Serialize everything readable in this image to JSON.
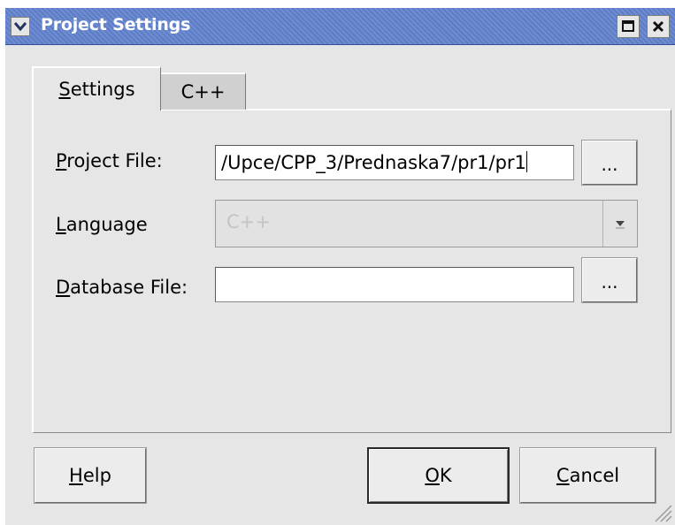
{
  "window": {
    "title": "Project Settings",
    "controls": {
      "menu_icon": "chevron-down-icon",
      "maximize_icon": "maximize-icon",
      "close_icon": "close-icon"
    }
  },
  "tabs": [
    {
      "label": "Settings",
      "mnemonic": "S",
      "rest": "ettings",
      "active": true
    },
    {
      "label": "C++",
      "active": false
    }
  ],
  "form": {
    "project_file": {
      "label_mnemonic": "P",
      "label_rest": "roject File:",
      "value": "/Upce/CPP_3/Prednaska7/pr1/pr1",
      "browse_label": "..."
    },
    "language": {
      "label_mnemonic": "L",
      "label_rest": "anguage",
      "value": "C++",
      "disabled": true
    },
    "database_file": {
      "label_mnemonic": "D",
      "label_rest": "atabase File:",
      "value": "",
      "browse_label": "..."
    }
  },
  "buttons": {
    "help": {
      "mnemonic": "H",
      "rest": "elp"
    },
    "ok": {
      "mnemonic": "O",
      "rest": "K"
    },
    "cancel": {
      "mnemonic": "C",
      "rest": "ancel"
    }
  },
  "colors": {
    "titlebar": "#6f8dd0",
    "dialog_bg": "#e6e6e6",
    "disabled_text": "#c4c4c4"
  }
}
